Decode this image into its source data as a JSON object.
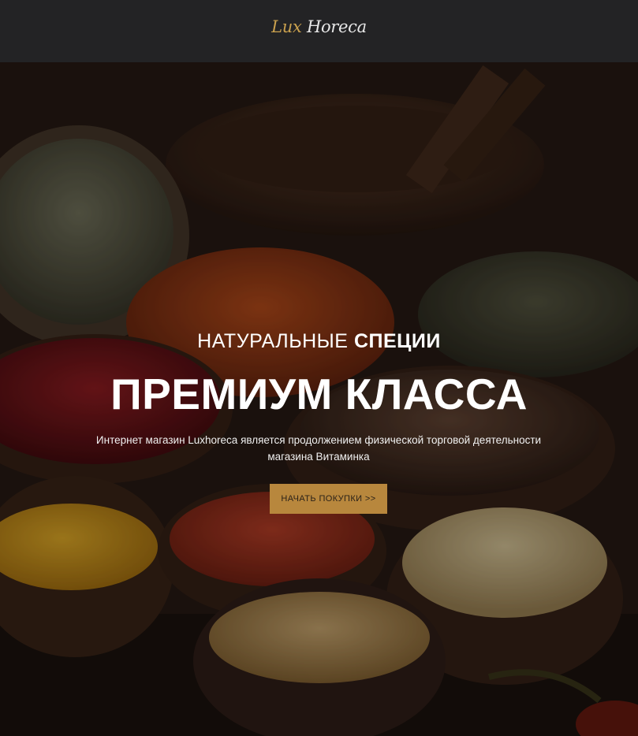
{
  "header": {
    "logo_part1": "Lux",
    "logo_part2": "Horeca"
  },
  "hero": {
    "subtitle_light": "НАТУРАЛЬНЫЕ",
    "subtitle_bold": "СПЕЦИИ",
    "title": "ПРЕМИУМ КЛАССА",
    "description": "Интернет магазин Luxhoreca является продолжением физической торговой деятельности магазина Витаминка",
    "cta_label": "НАЧАТЬ ПОКУПКИ >>"
  },
  "colors": {
    "header_bg": "#232325",
    "accent": "#b8873d",
    "logo_gold": "#c9a04e"
  }
}
